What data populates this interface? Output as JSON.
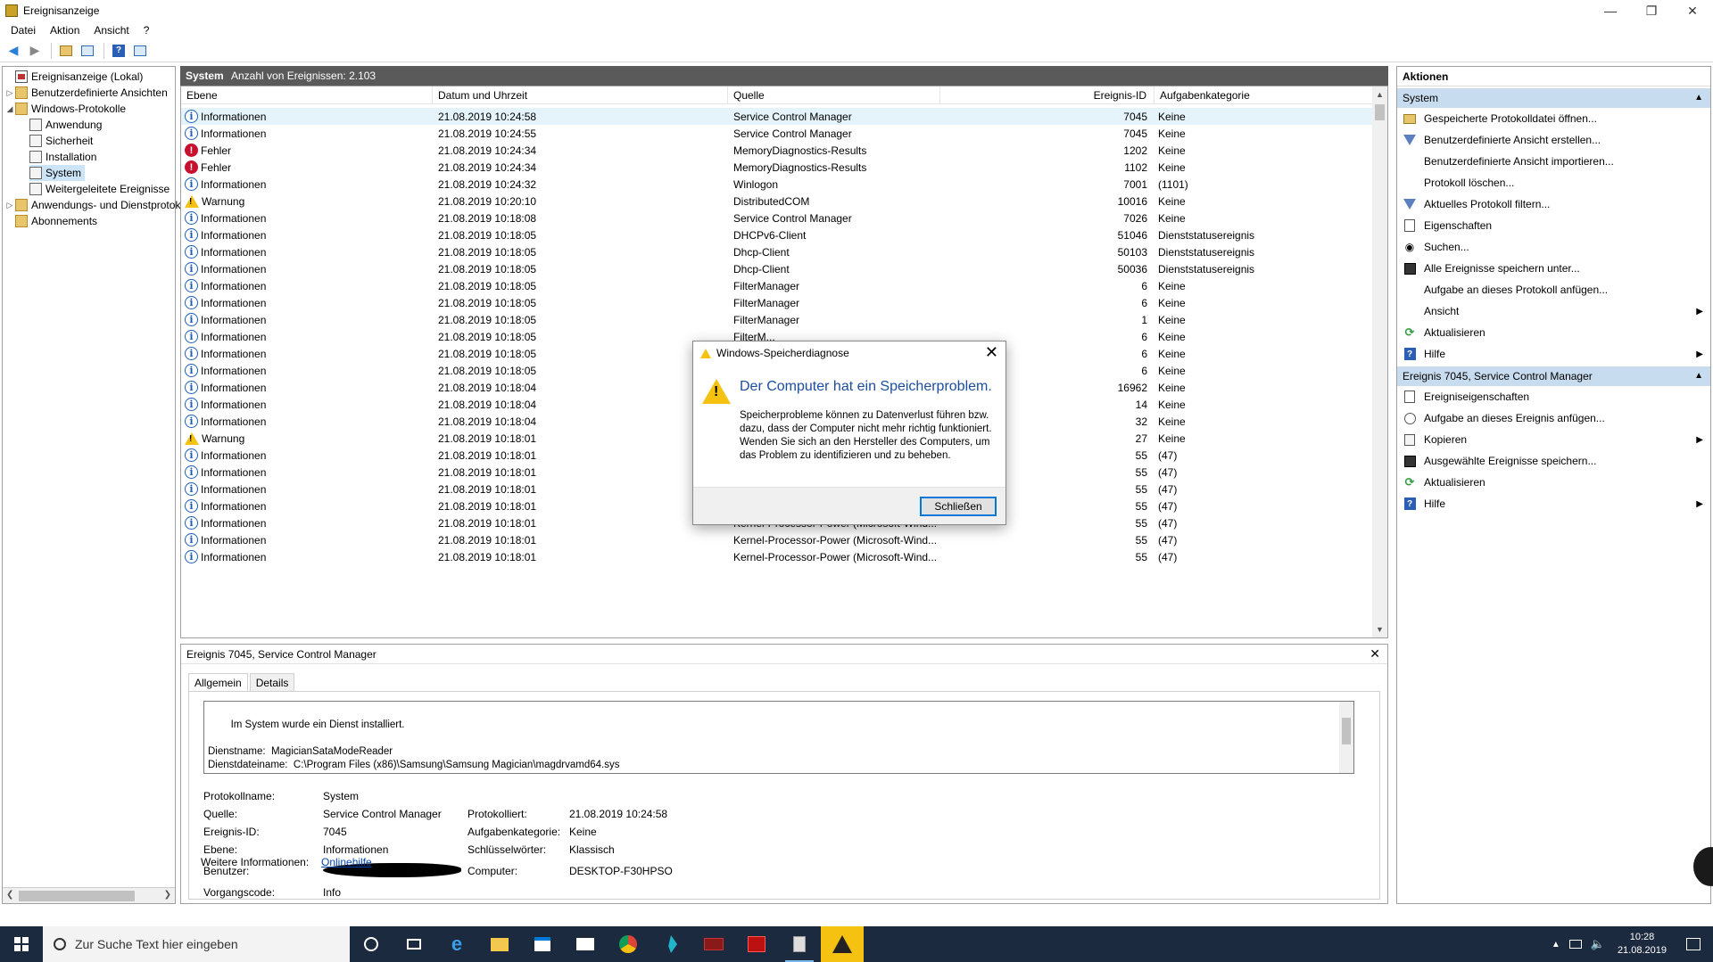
{
  "window": {
    "title": "Ereignisanzeige"
  },
  "menu": [
    "Datei",
    "Aktion",
    "Ansicht",
    "?"
  ],
  "tree": [
    {
      "label": "Ereignisanzeige (Lokal)",
      "level": 0,
      "icon": "event-viewer-icon",
      "arrow": ""
    },
    {
      "label": "Benutzerdefinierte Ansichten",
      "level": 1,
      "icon": "folder-icon",
      "arrow": ">"
    },
    {
      "label": "Windows-Protokolle",
      "level": 1,
      "icon": "folder-icon",
      "arrow": "v"
    },
    {
      "label": "Anwendung",
      "level": 2,
      "icon": "log-icon",
      "arrow": ""
    },
    {
      "label": "Sicherheit",
      "level": 2,
      "icon": "log-icon",
      "arrow": ""
    },
    {
      "label": "Installation",
      "level": 2,
      "icon": "log-icon",
      "arrow": ""
    },
    {
      "label": "System",
      "level": 2,
      "icon": "log-icon",
      "arrow": "",
      "selected": true
    },
    {
      "label": "Weitergeleitete Ereignisse",
      "level": 2,
      "icon": "log-icon",
      "arrow": ""
    },
    {
      "label": "Anwendungs- und Dienstprotokolle",
      "level": 1,
      "icon": "folder-icon",
      "arrow": ">"
    },
    {
      "label": "Abonnements",
      "level": 1,
      "icon": "folder-icon",
      "arrow": ""
    }
  ],
  "events_header": {
    "title": "System",
    "count": "Anzahl von Ereignissen: 2.103"
  },
  "columns": [
    "Ebene",
    "Datum und Uhrzeit",
    "Quelle",
    "Ereignis-ID",
    "Aufgabenkategorie"
  ],
  "events": [
    {
      "level": "Informationen",
      "kind": "info",
      "date": "21.08.2019 10:24:58",
      "source": "Service Control Manager",
      "id": "7045",
      "cat": "Keine"
    },
    {
      "level": "Informationen",
      "kind": "info",
      "date": "21.08.2019 10:24:55",
      "source": "Service Control Manager",
      "id": "7045",
      "cat": "Keine"
    },
    {
      "level": "Fehler",
      "kind": "err",
      "date": "21.08.2019 10:24:34",
      "source": "MemoryDiagnostics-Results",
      "id": "1202",
      "cat": "Keine"
    },
    {
      "level": "Fehler",
      "kind": "err",
      "date": "21.08.2019 10:24:34",
      "source": "MemoryDiagnostics-Results",
      "id": "1102",
      "cat": "Keine"
    },
    {
      "level": "Informationen",
      "kind": "info",
      "date": "21.08.2019 10:24:32",
      "source": "Winlogon",
      "id": "7001",
      "cat": "(1101)"
    },
    {
      "level": "Warnung",
      "kind": "warn",
      "date": "21.08.2019 10:20:10",
      "source": "DistributedCOM",
      "id": "10016",
      "cat": "Keine"
    },
    {
      "level": "Informationen",
      "kind": "info",
      "date": "21.08.2019 10:18:08",
      "source": "Service Control Manager",
      "id": "7026",
      "cat": "Keine"
    },
    {
      "level": "Informationen",
      "kind": "info",
      "date": "21.08.2019 10:18:05",
      "source": "DHCPv6-Client",
      "id": "51046",
      "cat": "Dienststatusereignis"
    },
    {
      "level": "Informationen",
      "kind": "info",
      "date": "21.08.2019 10:18:05",
      "source": "Dhcp-Client",
      "id": "50103",
      "cat": "Dienststatusereignis"
    },
    {
      "level": "Informationen",
      "kind": "info",
      "date": "21.08.2019 10:18:05",
      "source": "Dhcp-Client",
      "id": "50036",
      "cat": "Dienststatusereignis"
    },
    {
      "level": "Informationen",
      "kind": "info",
      "date": "21.08.2019 10:18:05",
      "source": "FilterManager",
      "id": "6",
      "cat": "Keine"
    },
    {
      "level": "Informationen",
      "kind": "info",
      "date": "21.08.2019 10:18:05",
      "source": "FilterManager",
      "id": "6",
      "cat": "Keine"
    },
    {
      "level": "Informationen",
      "kind": "info",
      "date": "21.08.2019 10:18:05",
      "source": "FilterManager",
      "id": "1",
      "cat": "Keine"
    },
    {
      "level": "Informationen",
      "kind": "info",
      "date": "21.08.2019 10:18:05",
      "source": "FilterM...",
      "id": "6",
      "cat": "Keine"
    },
    {
      "level": "Informationen",
      "kind": "info",
      "date": "21.08.2019 10:18:05",
      "source": "",
      "id": "6",
      "cat": "Keine"
    },
    {
      "level": "Informationen",
      "kind": "info",
      "date": "21.08.2019 10:18:05",
      "source": "",
      "id": "6",
      "cat": "Keine"
    },
    {
      "level": "Informationen",
      "kind": "info",
      "date": "21.08.2019 10:18:04",
      "source": "",
      "id": "16962",
      "cat": "Keine"
    },
    {
      "level": "Informationen",
      "kind": "info",
      "date": "21.08.2019 10:18:04",
      "source": "",
      "id": "14",
      "cat": "Keine"
    },
    {
      "level": "Informationen",
      "kind": "info",
      "date": "21.08.2019 10:18:04",
      "source": "",
      "id": "32",
      "cat": "Keine"
    },
    {
      "level": "Warnung",
      "kind": "warn",
      "date": "21.08.2019 10:18:01",
      "source": "",
      "id": "27",
      "cat": "Keine"
    },
    {
      "level": "Informationen",
      "kind": "info",
      "date": "21.08.2019 10:18:01",
      "source": "",
      "id": "55",
      "cat": "(47)"
    },
    {
      "level": "Informationen",
      "kind": "info",
      "date": "21.08.2019 10:18:01",
      "source": "",
      "id": "55",
      "cat": "(47)"
    },
    {
      "level": "Informationen",
      "kind": "info",
      "date": "21.08.2019 10:18:01",
      "source": "",
      "id": "55",
      "cat": "(47)"
    },
    {
      "level": "Informationen",
      "kind": "info",
      "date": "21.08.2019 10:18:01",
      "source": "",
      "id": "55",
      "cat": "(47)"
    },
    {
      "level": "Informationen",
      "kind": "info",
      "date": "21.08.2019 10:18:01",
      "source": "Kernel-Processor-Power (Microsoft-Wind...",
      "id": "55",
      "cat": "(47)"
    },
    {
      "level": "Informationen",
      "kind": "info",
      "date": "21.08.2019 10:18:01",
      "source": "Kernel-Processor-Power (Microsoft-Wind...",
      "id": "55",
      "cat": "(47)"
    },
    {
      "level": "Informationen",
      "kind": "info",
      "date": "21.08.2019 10:18:01",
      "source": "Kernel-Processor-Power (Microsoft-Wind...",
      "id": "55",
      "cat": "(47)"
    }
  ],
  "detail": {
    "title": "Ereignis 7045, Service Control Manager",
    "tabs": [
      "Allgemein",
      "Details"
    ],
    "description": "Im System wurde ein Dienst installiert.\n\nDienstname:  MagicianSataModeReader\nDienstdateiname:  C:\\Program Files (x86)\\Samsung\\Samsung Magician\\magdrvamd64.sys\nDiensttyp:  Kernelmodustreiber",
    "props": {
      "protokollname_label": "Protokollname:",
      "protokollname": "System",
      "quelle_label": "Quelle:",
      "quelle": "Service Control Manager",
      "protokolliert_label": "Protokolliert:",
      "protokolliert": "21.08.2019 10:24:58",
      "id_label": "Ereignis-ID:",
      "id": "7045",
      "aufgabe_label": "Aufgabenkategorie:",
      "aufgabe": "Keine",
      "ebene_label": "Ebene:",
      "ebene": "Informationen",
      "schluessel_label": "Schlüsselwörter:",
      "schluessel": "Klassisch",
      "benutzer_label": "Benutzer:",
      "computer_label": "Computer:",
      "computer": "DESKTOP-F30HPSO",
      "vorgang_label": "Vorgangscode:",
      "vorgang": "Info",
      "weitere_label": "Weitere Informationen:",
      "weitere": "Onlinehilfe"
    }
  },
  "actions": {
    "title": "Aktionen",
    "section1": "System",
    "items1": [
      {
        "label": "Gespeicherte Protokolldatei öffnen...",
        "icon": "open-folder-icon"
      },
      {
        "label": "Benutzerdefinierte Ansicht erstellen...",
        "icon": "filter-icon"
      },
      {
        "label": "Benutzerdefinierte Ansicht importieren...",
        "icon": "blank"
      },
      {
        "label": "Protokoll löschen...",
        "icon": "blank"
      },
      {
        "label": "Aktuelles Protokoll filtern...",
        "icon": "filter-icon"
      },
      {
        "label": "Eigenschaften",
        "icon": "properties-icon"
      },
      {
        "label": "Suchen...",
        "icon": "binoculars-icon"
      },
      {
        "label": "Alle Ereignisse speichern unter...",
        "icon": "save-icon"
      },
      {
        "label": "Aufgabe an dieses Protokoll anfügen...",
        "icon": "blank"
      },
      {
        "label": "Ansicht",
        "icon": "blank",
        "sub": true
      },
      {
        "label": "Aktualisieren",
        "icon": "refresh-icon"
      },
      {
        "label": "Hilfe",
        "icon": "help-icon",
        "sub": true
      }
    ],
    "section2": "Ereignis 7045, Service Control Manager",
    "items2": [
      {
        "label": "Ereigniseigenschaften",
        "icon": "properties-icon"
      },
      {
        "label": "Aufgabe an dieses Ereignis anfügen...",
        "icon": "task-icon"
      },
      {
        "label": "Kopieren",
        "icon": "copy-icon",
        "sub": true
      },
      {
        "label": "Ausgewählte Ereignisse speichern...",
        "icon": "save-icon"
      },
      {
        "label": "Aktualisieren",
        "icon": "refresh-icon"
      },
      {
        "label": "Hilfe",
        "icon": "help-icon",
        "sub": true
      }
    ]
  },
  "dialog": {
    "title": "Windows-Speicherdiagnose",
    "main": "Der Computer hat ein Speicherproblem.",
    "text": "Speicherprobleme können zu Datenverlust führen bzw. dazu, dass der Computer nicht mehr richtig funktioniert. Wenden Sie sich an den Hersteller des Computers, um das Problem zu identifizieren und zu beheben.",
    "button": "Schließen"
  },
  "taskbar": {
    "search_placeholder": "Zur Suche Text hier eingeben",
    "time": "10:28",
    "date": "21.08.2019"
  }
}
